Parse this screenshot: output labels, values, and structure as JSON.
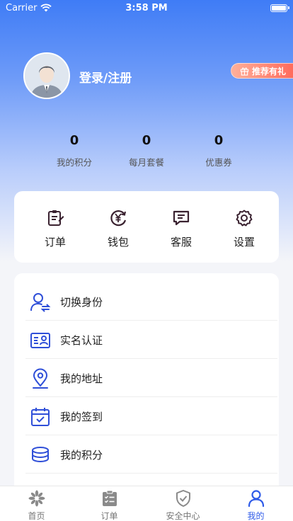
{
  "status_bar": {
    "carrier": "Carrier",
    "time": "3:58 PM"
  },
  "profile": {
    "login_label": "登录/注册",
    "referral_label": "推荐有礼"
  },
  "stats": [
    {
      "value": "0",
      "label": "我的积分"
    },
    {
      "value": "0",
      "label": "每月套餐"
    },
    {
      "value": "0",
      "label": "优惠券"
    }
  ],
  "quick_actions": [
    {
      "label": "订单",
      "icon": "order-clipboard-icon"
    },
    {
      "label": "钱包",
      "icon": "wallet-yen-icon"
    },
    {
      "label": "客服",
      "icon": "chat-icon"
    },
    {
      "label": "设置",
      "icon": "gear-icon"
    }
  ],
  "menu": [
    {
      "label": "切换身份",
      "icon": "switch-user-icon"
    },
    {
      "label": "实名认证",
      "icon": "id-card-icon"
    },
    {
      "label": "我的地址",
      "icon": "location-pin-icon"
    },
    {
      "label": "我的签到",
      "icon": "calendar-check-icon"
    },
    {
      "label": "我的积分",
      "icon": "coins-stack-icon"
    }
  ],
  "tabs": [
    {
      "label": "首页",
      "icon": "home-pinwheel-icon"
    },
    {
      "label": "订单",
      "icon": "order-list-icon"
    },
    {
      "label": "安全中心",
      "icon": "shield-check-icon"
    },
    {
      "label": "我的",
      "icon": "person-icon"
    }
  ],
  "colors": {
    "primary": "#2f5be8",
    "dark_icon": "#3a2230",
    "menu_icon": "#2f4fd8",
    "referral": "#ff6b5c"
  }
}
